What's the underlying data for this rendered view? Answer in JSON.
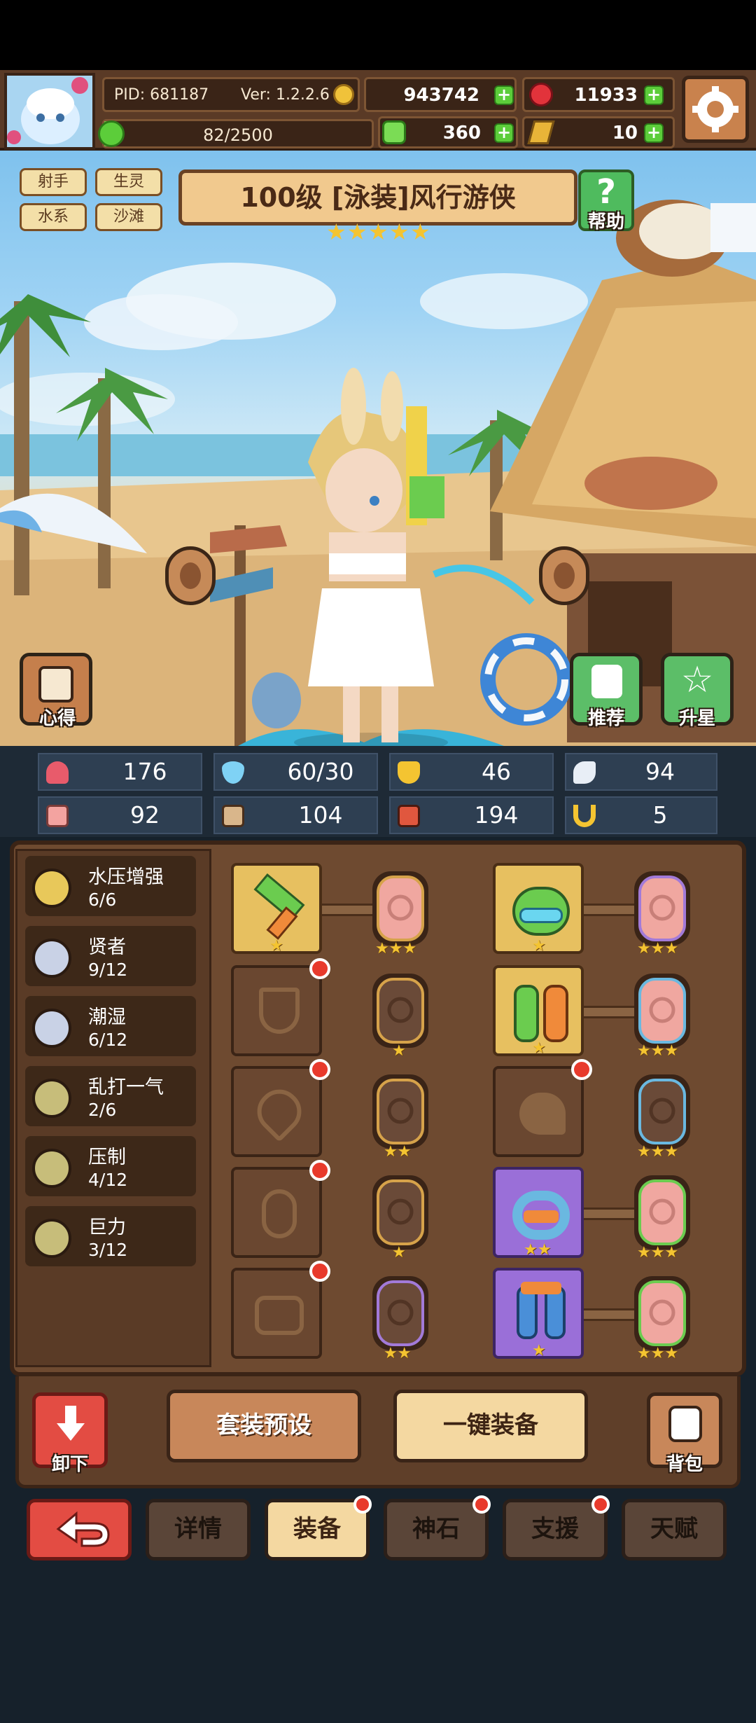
{
  "header": {
    "pid": "PID: 681187",
    "version": "Ver: 1.2.2.6",
    "gold": "943742",
    "ruby": "11933",
    "exp": "82/2500",
    "clover": "360",
    "key": "10"
  },
  "tags": [
    "射手",
    "生灵",
    "水系",
    "沙滩"
  ],
  "hero": {
    "title": "100级  [泳装]风行游侠",
    "stars": 5
  },
  "buttons": {
    "help": "帮助",
    "insight": "心得",
    "recommend": "推荐",
    "upgrade_star": "升星",
    "unequip": "卸下",
    "set_preset": "套装预设",
    "auto_equip": "一键装备",
    "backpack": "背包"
  },
  "stats": [
    {
      "icon": "heart-icon",
      "value": "176",
      "color": "#e85b6b"
    },
    {
      "icon": "water-drop-icon",
      "value": "60/30",
      "color": "#7fd2f5"
    },
    {
      "icon": "shield-icon",
      "value": "46",
      "color": "#f4c431"
    },
    {
      "icon": "wing-icon",
      "value": "94",
      "color": "#e8eef6"
    },
    {
      "icon": "fist-icon",
      "value": "92",
      "color": "#f3a3a0"
    },
    {
      "icon": "book-icon",
      "value": "104",
      "color": "#d9b68b"
    },
    {
      "icon": "crit-icon",
      "value": "194",
      "color": "#e0573e"
    },
    {
      "icon": "magnet-icon",
      "value": "5",
      "color": "#f4c431"
    }
  ],
  "sets": [
    {
      "name": "水压增强",
      "count": "6/6",
      "medal": "#e8c85a"
    },
    {
      "name": "贤者",
      "count": "9/12",
      "medal": "#c9d2e6"
    },
    {
      "name": "潮湿",
      "count": "6/12",
      "medal": "#c9d2e6"
    },
    {
      "name": "乱打一气",
      "count": "2/6",
      "medal": "#c7bd7a"
    },
    {
      "name": "压制",
      "count": "4/12",
      "medal": "#c7bd7a"
    },
    {
      "name": "巨力",
      "count": "3/12",
      "medal": "#c7bd7a"
    }
  ],
  "tabs": [
    "详情",
    "装备",
    "神石",
    "支援",
    "天赋"
  ],
  "active_tab": "装备"
}
